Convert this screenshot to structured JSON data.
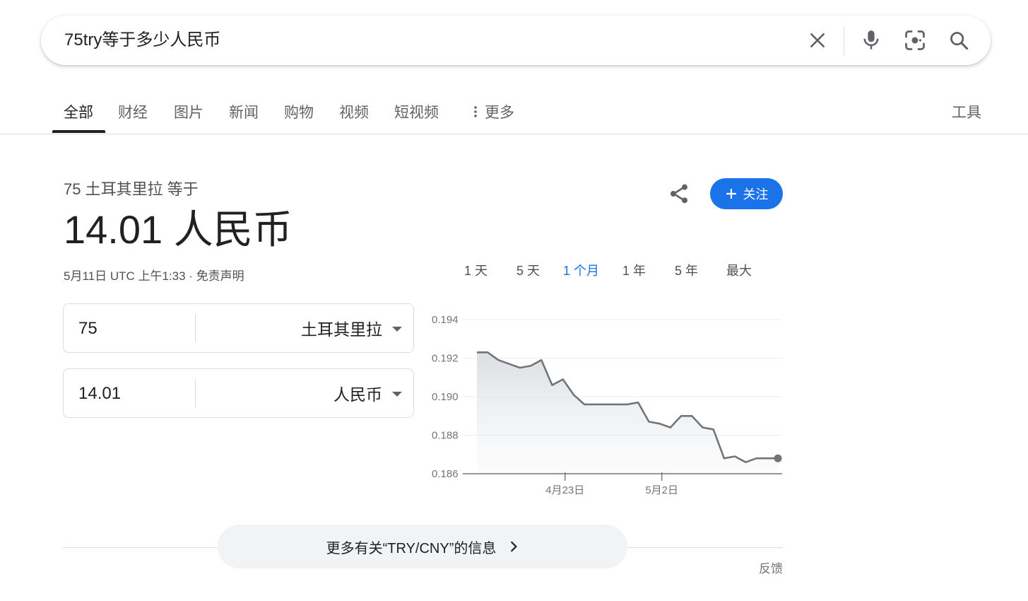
{
  "search": {
    "query": "75try等于多少人民币"
  },
  "tabs": {
    "items": [
      "全部",
      "财经",
      "图片",
      "新闻",
      "购物",
      "视频",
      "短视频"
    ],
    "more": "更多",
    "tools": "工具",
    "active": "全部"
  },
  "converter": {
    "subtitle": "75 土耳其里拉 等于",
    "result": "14.01 人民币",
    "timestamp": "5月11日 UTC 上午1:33 · ",
    "disclaimer": "免责声明",
    "follow_label": "关注",
    "from_amount": "75",
    "from_currency": "土耳其里拉",
    "to_amount": "14.01",
    "to_currency": "人民币"
  },
  "ranges": {
    "items": [
      "1 天",
      "5 天",
      "1 个月",
      "1 年",
      "5 年",
      "最大"
    ],
    "active": "1 个月"
  },
  "chart_data": {
    "type": "area",
    "ylim": [
      0.186,
      0.194
    ],
    "yticks": [
      "0.194",
      "0.192",
      "0.190",
      "0.188",
      "0.186"
    ],
    "xtick_labels": [
      "4月23日",
      "5月2日"
    ],
    "xtick_index": [
      8.2,
      17.2
    ],
    "values": [
      0.1923,
      0.1923,
      0.1919,
      0.1917,
      0.1915,
      0.1916,
      0.1919,
      0.1906,
      0.1909,
      0.1901,
      0.1896,
      0.1896,
      0.1896,
      0.1896,
      0.1896,
      0.1897,
      0.1887,
      0.1886,
      0.1884,
      0.189,
      0.189,
      0.1884,
      0.1883,
      0.1868,
      0.1869,
      0.1866,
      0.1868,
      0.1868,
      0.1868
    ],
    "color": "#70757a"
  },
  "footer": {
    "more_info": "更多有关“TRY/CNY”的信息",
    "feedback": "反馈"
  }
}
